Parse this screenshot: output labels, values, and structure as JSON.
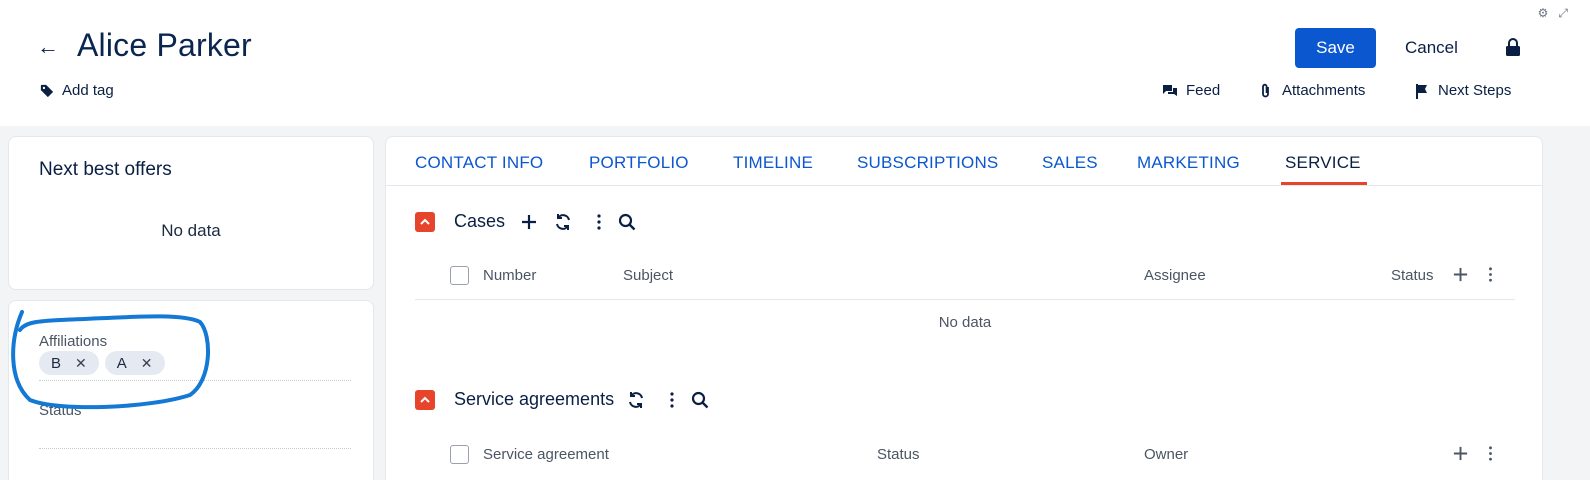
{
  "header": {
    "title": "Alice Parker",
    "add_tag": "Add tag",
    "save": "Save",
    "cancel": "Cancel",
    "actions": [
      "Feed",
      "Attachments",
      "Next Steps"
    ]
  },
  "next_best_offers": {
    "title": "Next best offers",
    "empty": "No data"
  },
  "affiliations": {
    "label": "Affiliations",
    "chips": [
      "B",
      "A"
    ],
    "status_label": "Status"
  },
  "tabs": [
    "CONTACT INFO",
    "PORTFOLIO",
    "TIMELINE",
    "SUBSCRIPTIONS",
    "SALES",
    "MARKETING",
    "SERVICE"
  ],
  "active_tab": "SERVICE",
  "cases": {
    "title": "Cases",
    "columns": [
      "Number",
      "Subject",
      "Assignee",
      "Status"
    ],
    "empty": "No data"
  },
  "service_agreements": {
    "title": "Service agreements",
    "columns": [
      "Service agreement",
      "Status",
      "Owner"
    ]
  },
  "colors": {
    "primary": "#0b57d0",
    "accent": "#e6452b",
    "annotation": "#1479d4"
  },
  "icons": [
    "back-arrow-icon",
    "tag-icon",
    "lock-icon",
    "feed-icon",
    "paperclip-icon",
    "flag-icon",
    "settings-icon",
    "expand-icon",
    "chevron-up-icon",
    "plus-icon",
    "refresh-icon",
    "more-vertical-icon",
    "search-icon"
  ]
}
